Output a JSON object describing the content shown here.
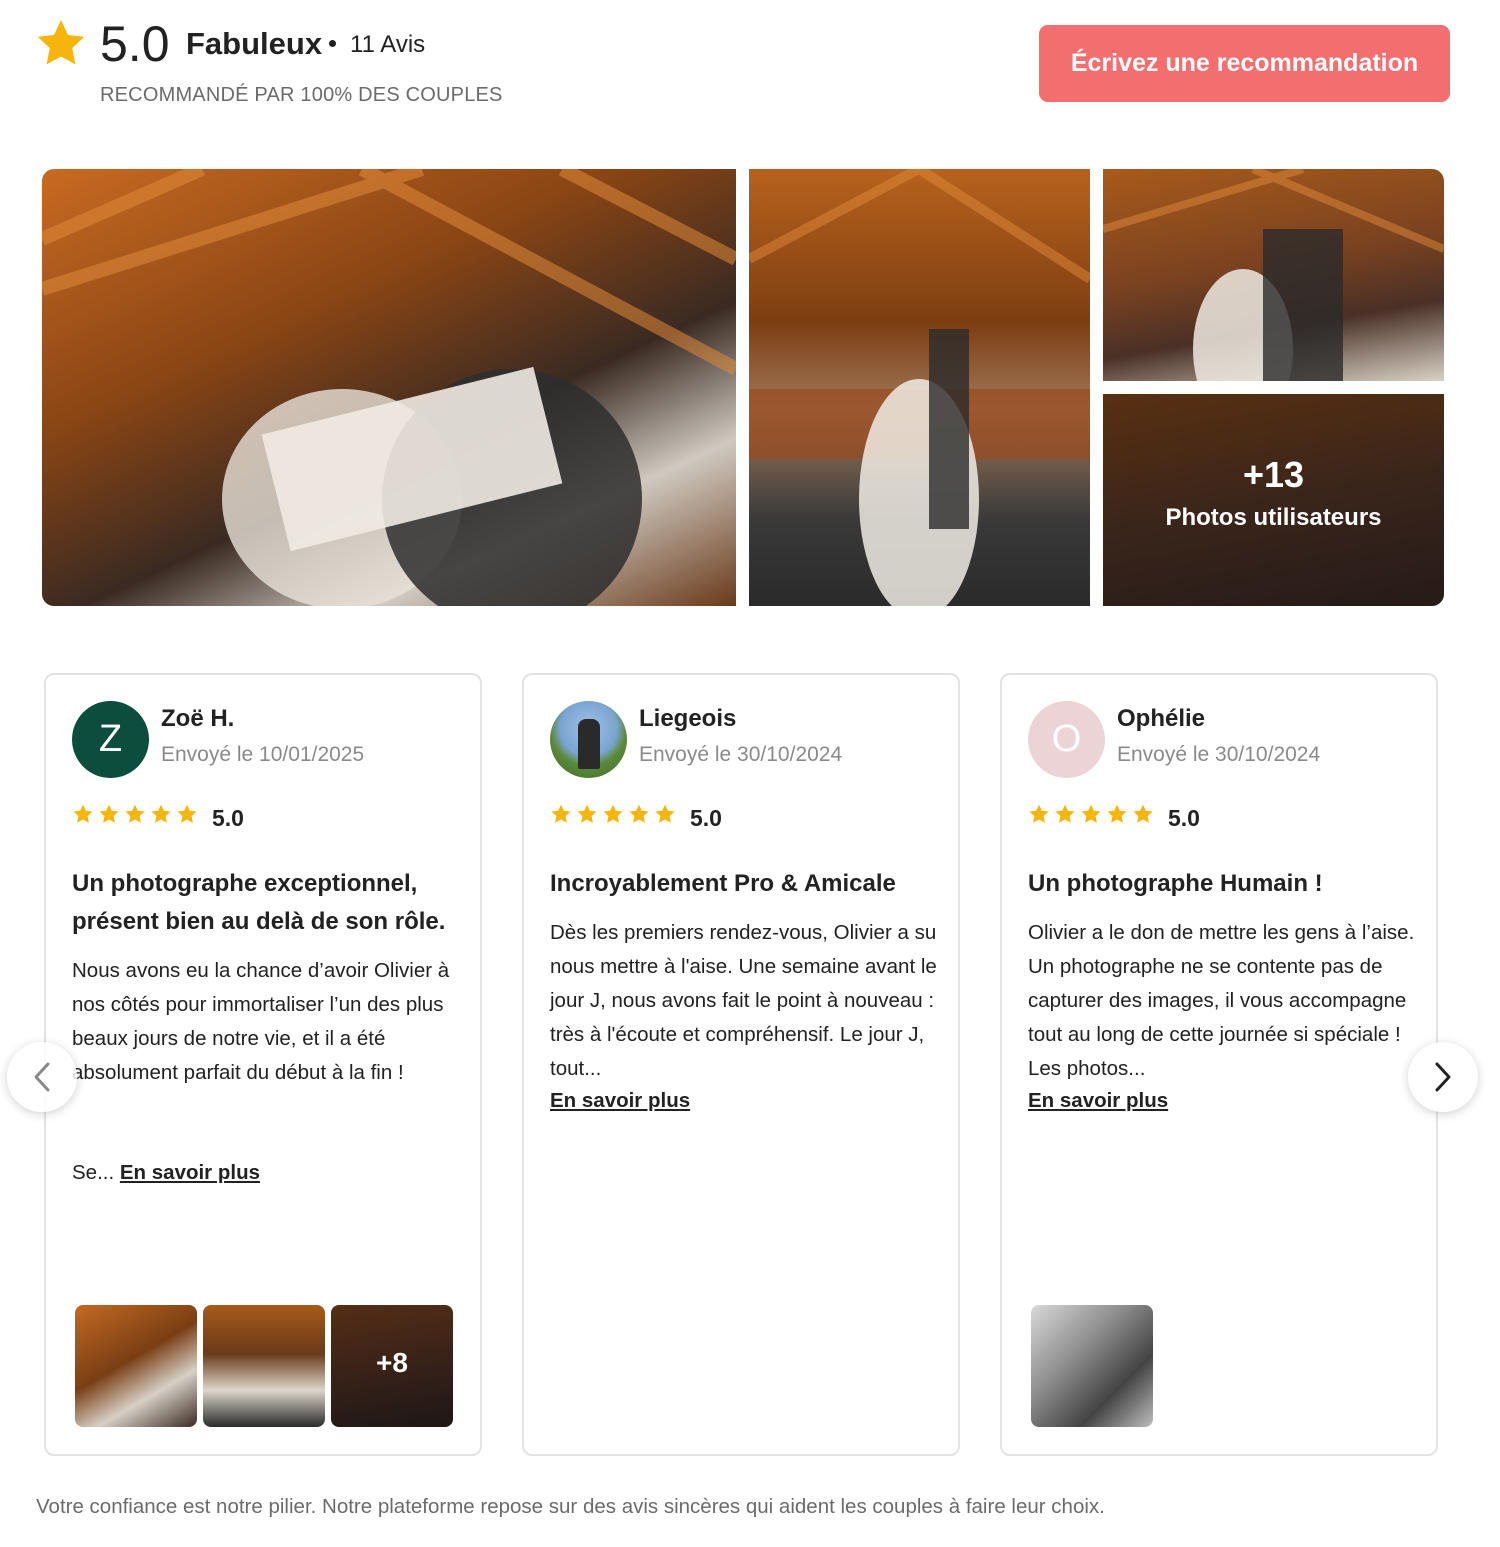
{
  "header": {
    "score": "5.0",
    "rating_label": "Fabuleux",
    "review_count": "11 Avis",
    "recommended": "RECOMMANDÉ PAR 100% DES COUPLES",
    "write_button": "Écrivez une recommandation",
    "star_icon": "star-icon"
  },
  "gallery": {
    "more_count": "+13",
    "more_label": "Photos utilisateurs"
  },
  "reviews": [
    {
      "initial": "Z",
      "name": "Zoë H.",
      "date": "Envoyé le 10/01/2025",
      "score": "5.0",
      "title": "Un photographe exceptionnel, présent bien au delà de son rôle.",
      "body": "Nous avons eu la chance d’avoir Olivier à nos côtés pour immortaliser l’un des plus beaux jours de notre vie, et il a été absolument parfait du début à la fin !",
      "more_prefix": "Se...",
      "more_link": "En savoir plus",
      "extra_photos": "+8"
    },
    {
      "name": "Liegeois",
      "date": "Envoyé le 30/10/2024",
      "score": "5.0",
      "title": "Incroyablement Pro & Amicale",
      "body": "Dès les premiers rendez-vous, Olivier a su nous mettre à l'aise. Une semaine avant le jour J, nous avons fait le point à nouveau : très à l'écoute et compréhensif. Le jour J, tout...",
      "more_link": "En savoir plus"
    },
    {
      "initial": "O",
      "name": "Ophélie",
      "date": "Envoyé le 30/10/2024",
      "score": "5.0",
      "title": "Un photographe Humain !",
      "body": "Olivier a le don de mettre les gens à l’aise. Un photographe ne se contente pas de capturer des images, il vous accompagne tout au long de cette journée si spéciale ! Les photos...",
      "more_link": "En savoir plus"
    }
  ],
  "footer": {
    "text": "Votre confiance est notre pilier. Notre plateforme repose sur des avis sincères qui aident les couples à faire leur choix."
  },
  "colors": {
    "accent": "#f36e6e",
    "star": "#f5b50a",
    "avatar_z": "#0b4e3d",
    "avatar_o": "#ecd3d6"
  }
}
